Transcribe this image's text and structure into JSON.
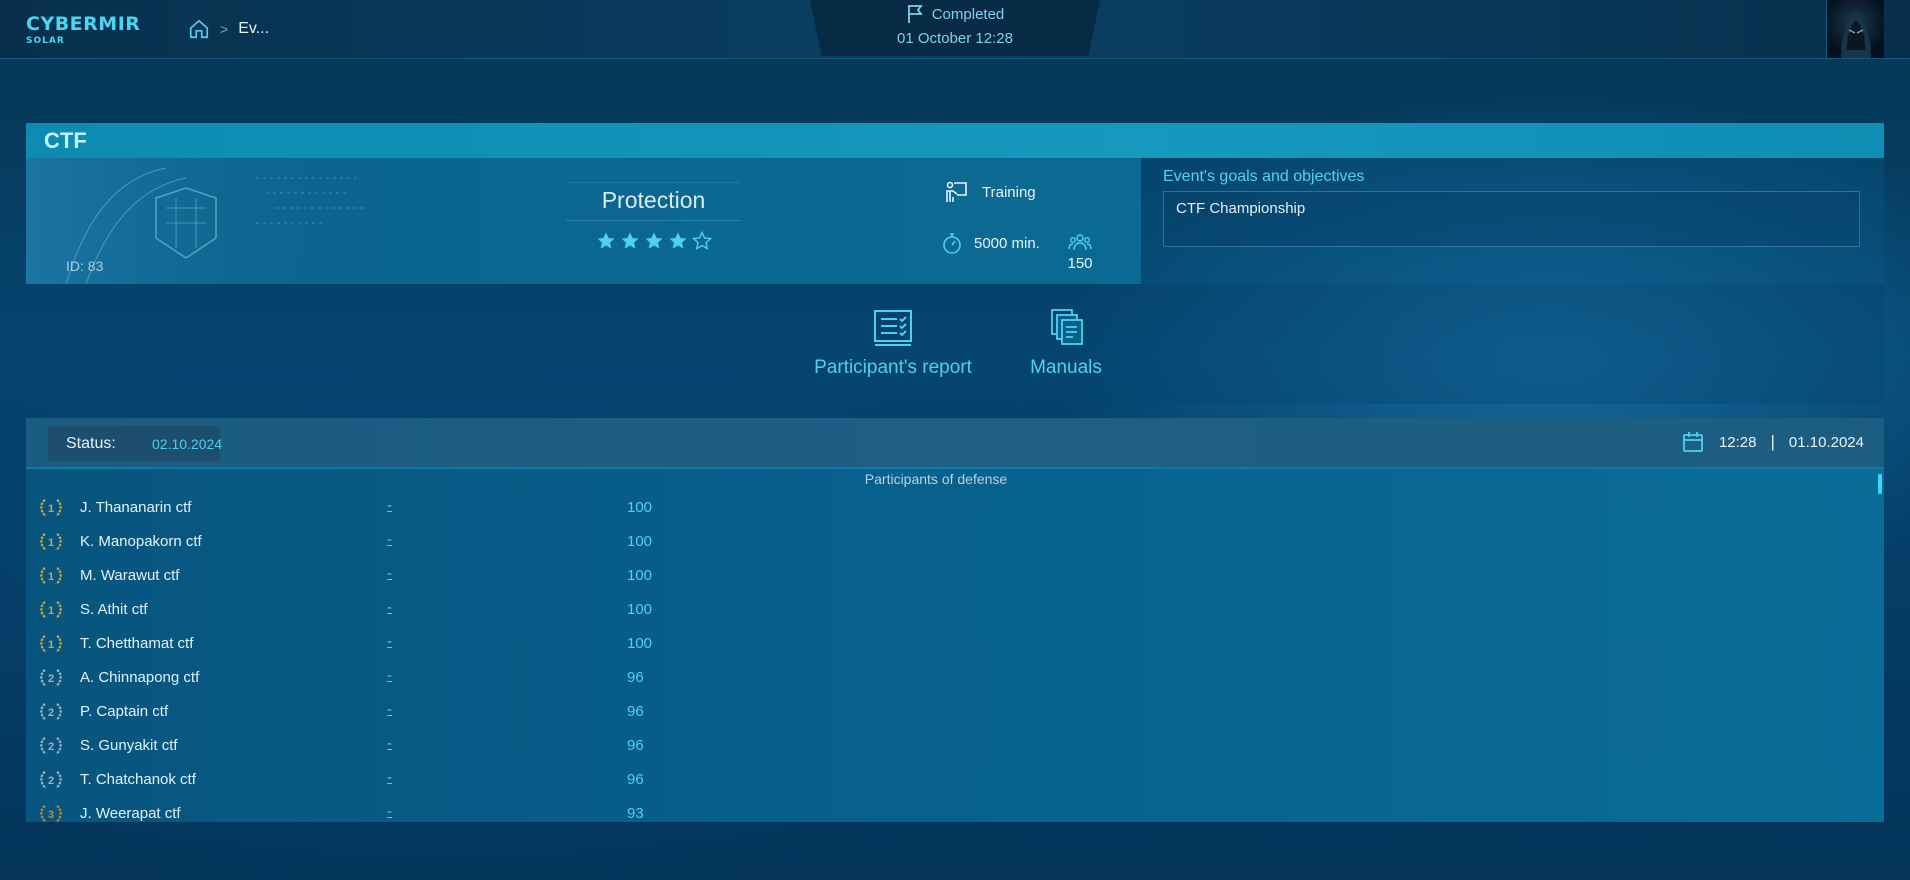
{
  "header": {
    "logo_main": "CYBERMIR",
    "logo_sub": "SOLAR",
    "breadcrumb_current": "Ev...",
    "status": "Completed",
    "datetime": "01 October 12:28"
  },
  "event": {
    "title": "CTF",
    "id_label": "ID: 83",
    "category": "Protection",
    "difficulty_stars": 4,
    "difficulty_max": 5,
    "type": "Training",
    "duration": "5000 min.",
    "participants": "150",
    "goals_title": "Event's goals and objectives",
    "goals_text": "CTF Championship"
  },
  "actions": {
    "report_label": "Participant's report",
    "manuals_label": "Manuals"
  },
  "results": {
    "status_label": "Status:",
    "status_value": "02.10.2024",
    "time": "12:28",
    "divider": "|",
    "date": "01.10.2024",
    "section_title": "Participants of defense",
    "rows": [
      {
        "place": "1",
        "name": "J. Thananarin ctf",
        "team": "-",
        "score": "100"
      },
      {
        "place": "1",
        "name": "K. Manopakorn ctf",
        "team": "-",
        "score": "100"
      },
      {
        "place": "1",
        "name": "M. Warawut ctf",
        "team": "-",
        "score": "100"
      },
      {
        "place": "1",
        "name": "S. Athit ctf",
        "team": "-",
        "score": "100"
      },
      {
        "place": "1",
        "name": "T. Chetthamat ctf",
        "team": "-",
        "score": "100"
      },
      {
        "place": "2",
        "name": "A. Chinnapong ctf",
        "team": "-",
        "score": "96"
      },
      {
        "place": "2",
        "name": "P. Captain ctf",
        "team": "-",
        "score": "96"
      },
      {
        "place": "2",
        "name": "S. Gunyakit ctf",
        "team": "-",
        "score": "96"
      },
      {
        "place": "2",
        "name": "T. Chatchanok ctf",
        "team": "-",
        "score": "96"
      },
      {
        "place": "3",
        "name": "J. Weerapat ctf",
        "team": "-",
        "score": "93"
      }
    ]
  },
  "colors": {
    "accent": "#4fd0ee",
    "gold": "#c9a93a",
    "silver": "#9fb3bf",
    "bronze": "#c28a3a"
  }
}
